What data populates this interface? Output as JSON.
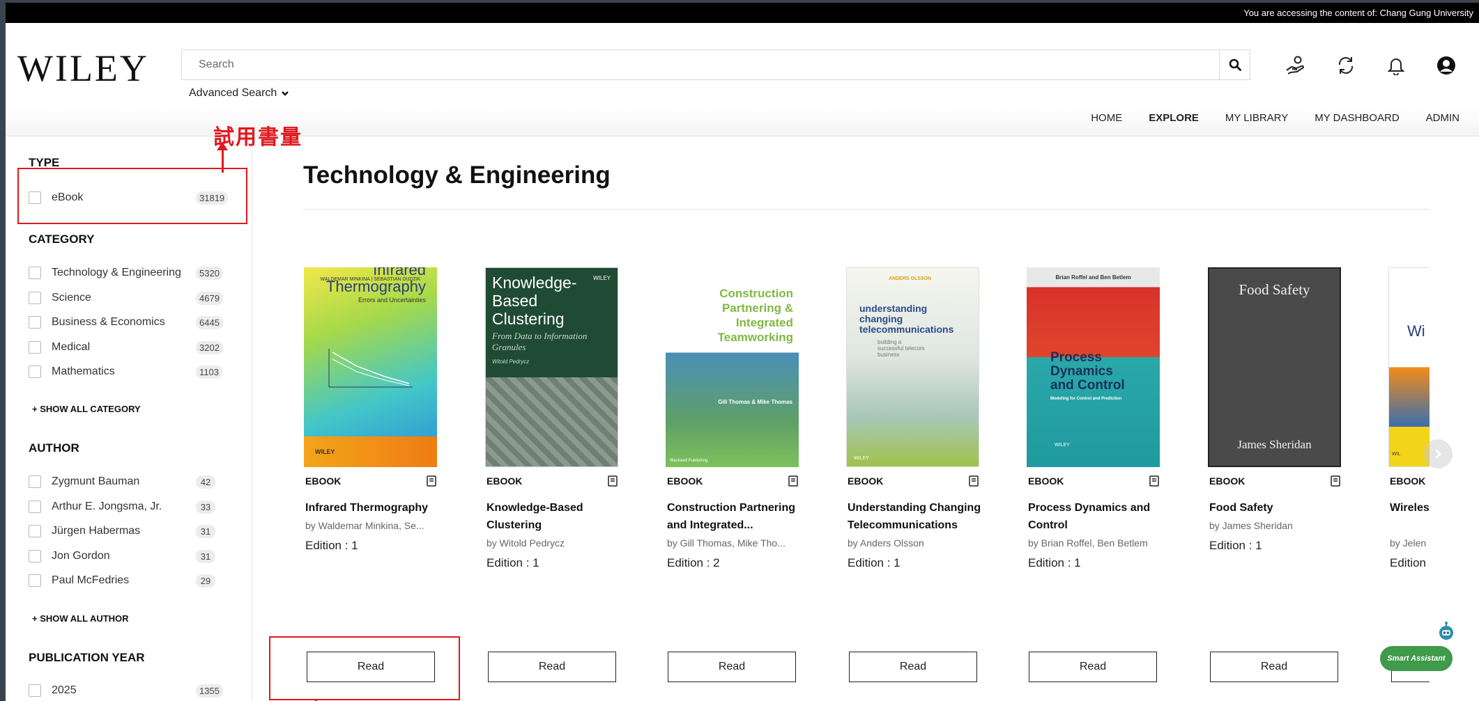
{
  "access_bar": {
    "text": "You are accessing the content of: Chang Gung University"
  },
  "header": {
    "logo": "WILEY",
    "search_placeholder": "Search",
    "advanced_search": "Advanced Search",
    "nav": [
      "HOME",
      "EXPLORE",
      "MY LIBRARY",
      "MY DASHBOARD",
      "ADMIN"
    ],
    "active_nav": "EXPLORE",
    "icons": [
      "search-icon",
      "hand-coin-icon",
      "sync-icon",
      "bell-icon",
      "user-account-icon"
    ]
  },
  "annotation": {
    "label": "試用書量",
    "color": "#e0191f"
  },
  "sidebar": {
    "type": {
      "title": "TYPE",
      "items": [
        {
          "label": "eBook",
          "count": "31819"
        }
      ]
    },
    "category": {
      "title": "CATEGORY",
      "items": [
        {
          "label": "Technology & Engineering",
          "count": "5320"
        },
        {
          "label": "Science",
          "count": "4679"
        },
        {
          "label": "Business & Economics",
          "count": "6445"
        },
        {
          "label": "Medical",
          "count": "3202"
        },
        {
          "label": "Mathematics",
          "count": "1103"
        }
      ],
      "show_all": "+ SHOW ALL CATEGORY"
    },
    "author": {
      "title": "AUTHOR",
      "items": [
        {
          "label": "Zygmunt Bauman",
          "count": "42"
        },
        {
          "label": "Arthur E. Jongsma, Jr.",
          "count": "33"
        },
        {
          "label": "Jürgen Habermas",
          "count": "31"
        },
        {
          "label": "Jon Gordon",
          "count": "31"
        },
        {
          "label": "Paul McFedries",
          "count": "29"
        }
      ],
      "show_all": "+ SHOW ALL AUTHOR"
    },
    "year": {
      "title": "PUBLICATION YEAR",
      "items": [
        {
          "label": "2025",
          "count": "1355"
        }
      ]
    }
  },
  "content": {
    "title": "Technology & Engineering",
    "read_label": "Read",
    "books": [
      {
        "type": "EBOOK",
        "title": "Infrared Thermography",
        "author": "by Waldemar Minkina, Se...",
        "edition": "Edition : 1",
        "cover": {
          "top": "WALDEMAR MINKINA | SEBASTIAN DUDZIK",
          "main": "Infrared Thermography",
          "sub": "Errors and Uncertainties",
          "brand": "WILEY"
        }
      },
      {
        "type": "EBOOK",
        "title": "Knowledge-Based Clustering",
        "author": "by Witold Pedrycz",
        "edition": "Edition : 1",
        "cover": {
          "top": "WILEY",
          "main": "Knowledge-Based Clustering",
          "sub": "From Data to Information Granules",
          "brand": "Witold Pedrycz"
        }
      },
      {
        "type": "EBOOK",
        "title": "Construction Partnering and Integrated...",
        "author": "by Gill Thomas, Mike Tho...",
        "edition": "Edition : 2",
        "cover": {
          "top": "",
          "main": "Construction Partnering & Integrated Teamworking",
          "sub": "Gill Thomas & Mike Thomas",
          "brand": "Blackwell Publishing"
        }
      },
      {
        "type": "EBOOK",
        "title": "Understanding Changing Telecommunications",
        "author": "by Anders Olsson",
        "edition": "Edition : 1",
        "cover": {
          "top": "ANDERS OLSSON",
          "main": "understanding changing telecommunications",
          "sub": "building a successful telecom business",
          "brand": "WILEY"
        }
      },
      {
        "type": "EBOOK",
        "title": "Process Dynamics and Control",
        "author": "by Brian Roffel, Ben Betlem",
        "edition": "Edition : 1",
        "cover": {
          "top": "Brian Roffel and Ben Betlem",
          "main": "Process Dynamics and Control",
          "sub": "Modeling for Control and Prediction",
          "brand": "WILEY"
        }
      },
      {
        "type": "EBOOK",
        "title": "Food Safety",
        "author": "by James Sheridan",
        "edition": "Edition : 1",
        "cover": {
          "top": "",
          "main": "Food Safety",
          "sub": "",
          "brand": "James Sheridan"
        }
      },
      {
        "type": "EBOOK",
        "title": "Wireles Networ",
        "author": "by Jelen",
        "edition": "Edition",
        "cover": {
          "top": "",
          "main": "Wi",
          "sub": "",
          "brand": "WIL"
        }
      }
    ]
  },
  "smart_assistant": {
    "label": "Smart Assistant"
  }
}
